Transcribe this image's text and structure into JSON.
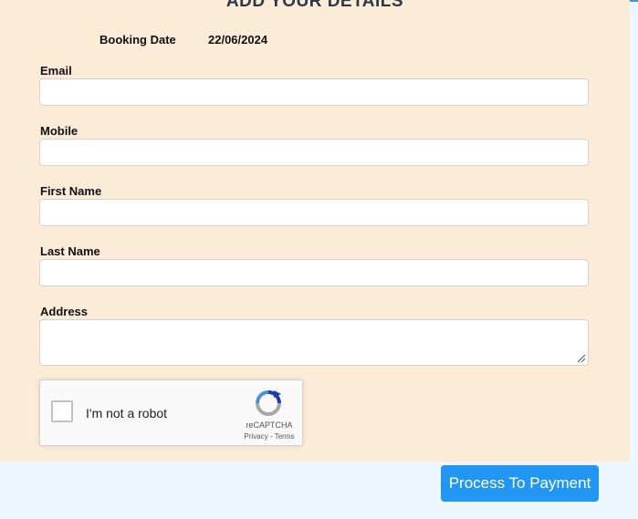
{
  "form": {
    "title": "ADD YOUR DETAILS",
    "booking_date_label": "Booking Date",
    "booking_date_value": "22/06/2024",
    "fields": [
      {
        "label": "Email",
        "value": "",
        "placeholder": ""
      },
      {
        "label": "Mobile",
        "value": "",
        "placeholder": ""
      },
      {
        "label": "First Name",
        "value": "",
        "placeholder": ""
      },
      {
        "label": "Last Name",
        "value": "",
        "placeholder": ""
      },
      {
        "label": "Address",
        "value": "",
        "placeholder": ""
      }
    ]
  },
  "captcha": {
    "checkbox_label": "I'm not a robot",
    "brand": "reCAPTCHA",
    "links": "Privacy - Terms",
    "logo_icon": "recaptcha-icon"
  },
  "actions": {
    "pay_label": "Process To Payment"
  },
  "colors": {
    "panel_bg": "#fbebd7",
    "page_bg": "#eef6fd",
    "button_bg": "#2196f3"
  }
}
